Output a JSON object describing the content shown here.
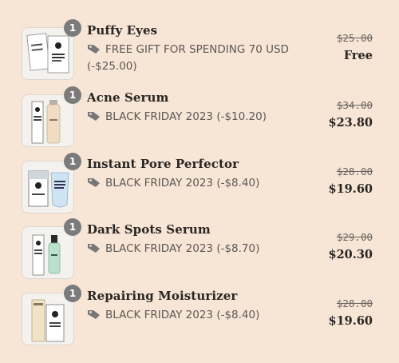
{
  "cart_items": [
    {
      "quantity": "1",
      "name": "Puffy Eyes",
      "discount": "FREE GIFT FOR SPENDING 70 USD (-$25.00)",
      "original_price": "$25.00",
      "price": "Free"
    },
    {
      "quantity": "1",
      "name": "Acne Serum",
      "discount": "BLACK FRIDAY 2023 (-$10.20)",
      "original_price": "$34.00",
      "price": "$23.80"
    },
    {
      "quantity": "1",
      "name": "Instant Pore Perfector",
      "discount": "BLACK FRIDAY 2023 (-$8.40)",
      "original_price": "$28.00",
      "price": "$19.60"
    },
    {
      "quantity": "1",
      "name": "Dark Spots Serum",
      "discount": "BLACK FRIDAY 2023 (-$8.70)",
      "original_price": "$29.00",
      "price": "$20.30"
    },
    {
      "quantity": "1",
      "name": "Repairing Moisturizer",
      "discount": "BLACK FRIDAY 2023 (-$8.40)",
      "original_price": "$28.00",
      "price": "$19.60"
    }
  ],
  "icons": {
    "discount": "price-tag-icon"
  },
  "colors": {
    "background": "#f7e5d6",
    "badge": "#7b7b7b",
    "text": "#2a2623",
    "muted": "#5d5955"
  }
}
